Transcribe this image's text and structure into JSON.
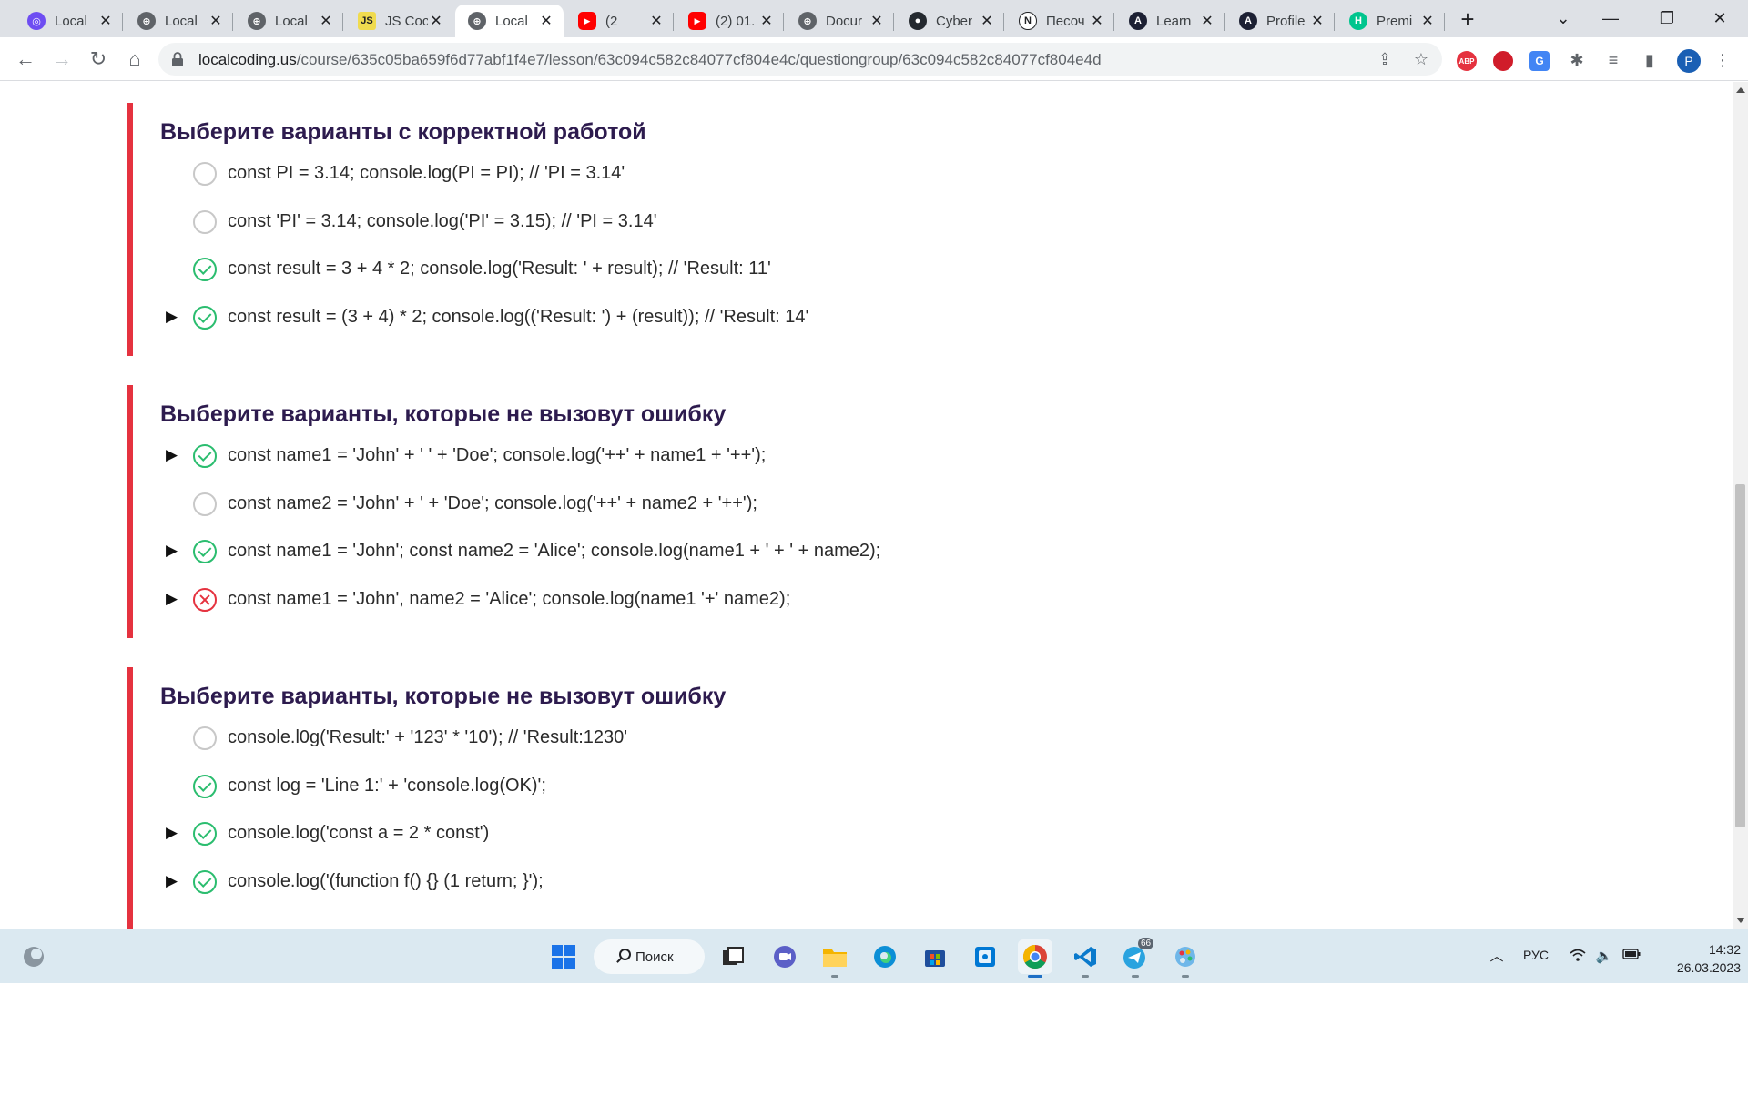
{
  "browser": {
    "tabs": [
      {
        "title": "Local",
        "favicon_color": "#6e4df2",
        "favicon_glyph": "◎"
      },
      {
        "title": "Local",
        "favicon_color": "#5f6368",
        "favicon_glyph": "⊕"
      },
      {
        "title": "Local",
        "favicon_color": "#5f6368",
        "favicon_glyph": "⊕"
      },
      {
        "title": "JS Coc",
        "favicon_color": "#f0db4f",
        "favicon_glyph": "JS"
      },
      {
        "title": "Local",
        "favicon_color": "#5f6368",
        "favicon_glyph": "⊕"
      },
      {
        "title": "(2",
        "favicon_color": "#ff0000",
        "favicon_glyph": "▶"
      },
      {
        "title": "(2) 01.",
        "favicon_color": "#ff0000",
        "favicon_glyph": "▶"
      },
      {
        "title": "Docur",
        "favicon_color": "#5f6368",
        "favicon_glyph": "⊕"
      },
      {
        "title": "Cyber",
        "favicon_color": "#24292f",
        "favicon_glyph": "●"
      },
      {
        "title": "Песоч",
        "favicon_color": "#ffffff",
        "favicon_glyph": "N"
      },
      {
        "title": "Learn",
        "favicon_color": "#1c2033",
        "favicon_glyph": "A"
      },
      {
        "title": "Profile",
        "favicon_color": "#1c2033",
        "favicon_glyph": "A"
      },
      {
        "title": "Premi",
        "favicon_color": "#00c58e",
        "favicon_glyph": "H"
      }
    ],
    "active_tab_index": 4,
    "url_host": "localcoding.us",
    "url_path": "/course/635c05ba659f6d77abf1f4e7/lesson/63c094c582c84077cf804e4c/questiongroup/63c094c582c84077cf804e4d",
    "extensions": [
      {
        "name": "adblock-icon",
        "label": "ABP",
        "color": "#e5323f"
      },
      {
        "name": "opera-addon-icon",
        "label": "",
        "color": "#d01c2a"
      },
      {
        "name": "translate-icon",
        "label": "G",
        "color": "#4285f4"
      }
    ],
    "profile_initial": "P"
  },
  "questions": [
    {
      "title": "Выберите варианты с корректной работой",
      "options": [
        {
          "code": "const PI = 3.14; console.log(PI = PI); // 'PI = 3.14'",
          "status": "empty",
          "expandable": false
        },
        {
          "code": "const 'PI' = 3.14; console.log('PI' = 3.15); // 'PI = 3.14'",
          "status": "empty",
          "expandable": false
        },
        {
          "code": "const result = 3 + 4 * 2; console.log('Result: ' + result); // 'Result: 11'",
          "status": "correct",
          "expandable": false
        },
        {
          "code": "const result = (3 + 4) * 2; console.log(('Result: ') + (result)); // 'Result: 14'",
          "status": "correct",
          "expandable": true
        }
      ]
    },
    {
      "title": "Выберите варианты, которые не вызовут ошибку",
      "options": [
        {
          "code": "const name1 = 'John' + ' ' + 'Doe'; console.log('++' + name1 + '++');",
          "status": "correct",
          "expandable": true
        },
        {
          "code": "const name2 = 'John' + ' + 'Doe'; console.log('++' + name2 + '++');",
          "status": "empty",
          "expandable": false
        },
        {
          "code": "const name1 = 'John'; const name2 = 'Alice'; console.log(name1 + ' + ' + name2);",
          "status": "correct",
          "expandable": true
        },
        {
          "code": "const name1 = 'John', name2 = 'Alice'; console.log(name1 '+' name2);",
          "status": "wrong",
          "expandable": true
        }
      ]
    },
    {
      "title": "Выберите варианты, которые не вызовут ошибку",
      "options": [
        {
          "code": "console.l0g('Result:' + '123' * '10'); // 'Result:1230'",
          "status": "empty",
          "expandable": false
        },
        {
          "code": "const log = 'Line 1:' + 'console.log(OK)';",
          "status": "correct",
          "expandable": false
        },
        {
          "code": "console.log('const a = 2 * const')",
          "status": "correct",
          "expandable": true
        },
        {
          "code": "console.log('(function f() {} (1 return; }');",
          "status": "correct",
          "expandable": true
        }
      ]
    }
  ],
  "taskbar": {
    "search_label": "Поиск",
    "apps": [
      "windows-start-icon",
      "task-view-icon",
      "teams-chat-icon",
      "file-explorer-icon",
      "edge-icon",
      "microsoft-store-icon",
      "photos-app-icon",
      "chrome-icon",
      "vscode-icon",
      "telegram-icon",
      "paint-icon"
    ],
    "active_app": "chrome-icon",
    "telegram_badge": "66",
    "language": "РУС",
    "time": "14:32",
    "date": "26.03.2023"
  },
  "colors": {
    "accent_bar": "#e5323f",
    "correct": "#2bbd6f",
    "wrong": "#e5323f",
    "heading": "#2d1b4e"
  }
}
